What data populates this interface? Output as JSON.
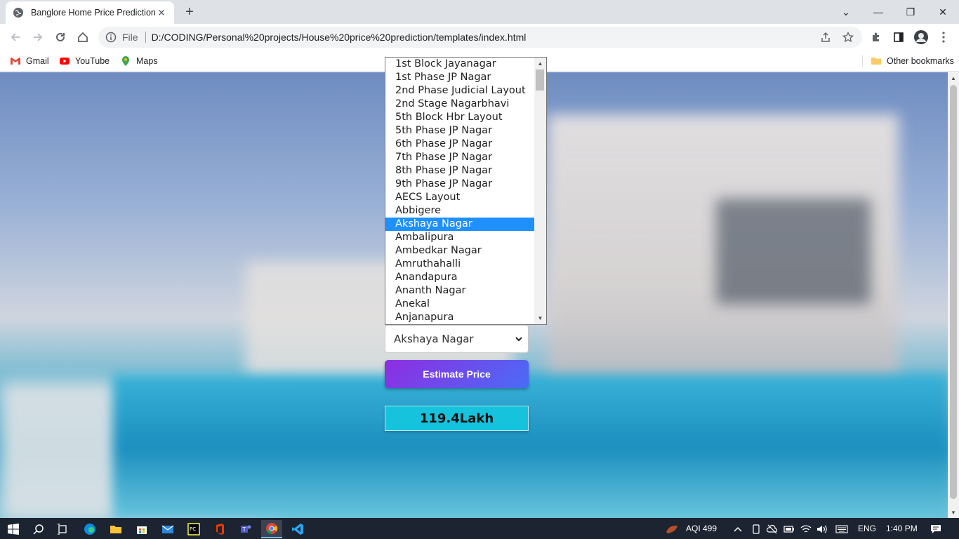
{
  "browser": {
    "tab_title": "Banglore Home Price Prediction",
    "address_scheme": "File",
    "address_url": "D:/CODING/Personal%20projects/House%20price%20prediction/templates/index.html",
    "bookmarks": [
      {
        "label": "Gmail",
        "icon": "gmail-icon"
      },
      {
        "label": "YouTube",
        "icon": "youtube-icon"
      },
      {
        "label": "Maps",
        "icon": "maps-icon"
      }
    ],
    "other_bookmarks": "Other bookmarks"
  },
  "form": {
    "location_options": [
      "1st Block Jayanagar",
      "1st Phase JP Nagar",
      "2nd Phase Judicial Layout",
      "2nd Stage Nagarbhavi",
      "5th Block Hbr Layout",
      "5th Phase JP Nagar",
      "6th Phase JP Nagar",
      "7th Phase JP Nagar",
      "8th Phase JP Nagar",
      "9th Phase JP Nagar",
      "AECS Layout",
      "Abbigere",
      "Akshaya Nagar",
      "Ambalipura",
      "Ambedkar Nagar",
      "Amruthahalli",
      "Anandapura",
      "Ananth Nagar",
      "Anekal",
      "Anjanapura"
    ],
    "selected_location": "Akshaya Nagar",
    "estimate_button": "Estimate Price",
    "result": "119.4Lakh"
  },
  "taskbar": {
    "aqi": "AQI 499",
    "language": "ENG",
    "time": "1:40 PM"
  },
  "colors": {
    "button_gradient_start": "#8e2de2",
    "button_gradient_end": "#4a6cf7",
    "result_bg": "#16c3dd",
    "selected_option": "#1e90ff"
  }
}
